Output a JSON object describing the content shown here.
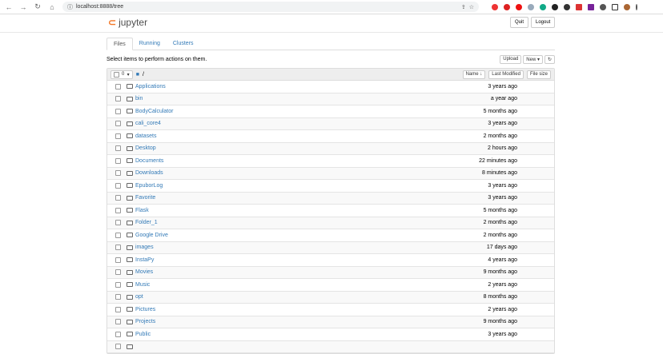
{
  "browser": {
    "url": "localhost:8888/tree"
  },
  "header": {
    "logo": "jupyter",
    "quit": "Quit",
    "logout": "Logout"
  },
  "tabs": [
    "Files",
    "Running",
    "Clusters"
  ],
  "toolbar": {
    "hint": "Select items to perform actions on them.",
    "upload": "Upload",
    "new": "New ▾",
    "refresh": "↻"
  },
  "list_header": {
    "count": "0",
    "path": "/",
    "sort_name": "Name ↓",
    "last_modified": "Last Modified",
    "file_size": "File size"
  },
  "files": [
    {
      "name": "Applications",
      "modified": "3 years ago"
    },
    {
      "name": "bin",
      "modified": "a year ago"
    },
    {
      "name": "BodyCalculator",
      "modified": "5 months ago"
    },
    {
      "name": "cali_core4",
      "modified": "3 years ago"
    },
    {
      "name": "datasets",
      "modified": "2 months ago"
    },
    {
      "name": "Desktop",
      "modified": "2 hours ago"
    },
    {
      "name": "Documents",
      "modified": "22 minutes ago"
    },
    {
      "name": "Downloads",
      "modified": "8 minutes ago"
    },
    {
      "name": "EpuborLog",
      "modified": "3 years ago"
    },
    {
      "name": "Favorite",
      "modified": "3 years ago"
    },
    {
      "name": "Flask",
      "modified": "5 months ago"
    },
    {
      "name": "Folder_1",
      "modified": "2 months ago"
    },
    {
      "name": "Google Drive",
      "modified": "2 months ago"
    },
    {
      "name": "images",
      "modified": "17 days ago"
    },
    {
      "name": "InstaPy",
      "modified": "4 years ago"
    },
    {
      "name": "Movies",
      "modified": "9 months ago"
    },
    {
      "name": "Music",
      "modified": "2 years ago"
    },
    {
      "name": "opt",
      "modified": "8 months ago"
    },
    {
      "name": "Pictures",
      "modified": "2 years ago"
    },
    {
      "name": "Projects",
      "modified": "9 months ago"
    },
    {
      "name": "Public",
      "modified": "3 years ago"
    },
    {
      "name": "",
      "modified": ""
    }
  ]
}
